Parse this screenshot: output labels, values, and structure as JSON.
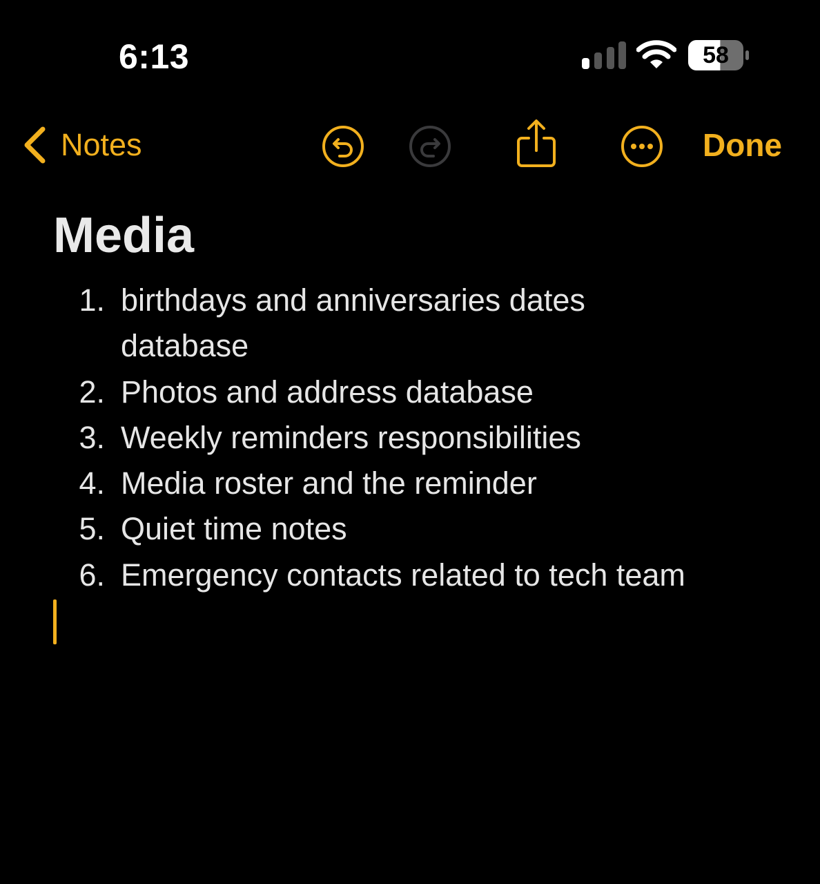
{
  "status_bar": {
    "time": "6:13",
    "battery_percent": "58",
    "icons": [
      "cellular-signal-icon",
      "wifi-icon",
      "battery-icon"
    ]
  },
  "toolbar": {
    "back_label": "Notes",
    "done_label": "Done",
    "icons": [
      "chevron-left-icon",
      "undo-icon",
      "redo-icon",
      "share-icon",
      "more-icon"
    ]
  },
  "note": {
    "title": "Media",
    "items": [
      {
        "number": "1.",
        "text": "birthdays  and anniversaries dates database"
      },
      {
        "number": "2.",
        "text": "Photos and address database"
      },
      {
        "number": "3.",
        "text": "Weekly reminders responsibilities"
      },
      {
        "number": "4.",
        "text": "Media roster and the reminder"
      },
      {
        "number": "5.",
        "text": "Quiet time notes"
      },
      {
        "number": "6.",
        "text": "Emergency contacts related to tech team"
      }
    ]
  },
  "colors": {
    "accent": "#f2b01e",
    "background": "#000000",
    "text": "#e6e6e6",
    "disabled_icon": "#3a3a3c"
  }
}
